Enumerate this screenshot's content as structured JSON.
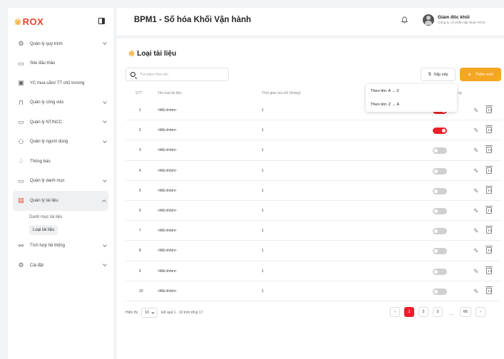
{
  "brand": {
    "logo_text": "ROX",
    "logo_mark": "※",
    "accent_color": "#f5a623",
    "brand_red": "#e8212c"
  },
  "sidebar": {
    "items": [
      {
        "label": "Quản lý quy trình",
        "icon": "workflow-icon",
        "glyph": "⚙",
        "has_chevron": true
      },
      {
        "label": "Site đấu thầu",
        "icon": "monitor-icon",
        "glyph": "▭",
        "has_chevron": false
      },
      {
        "label": "YC mua sắm/ TT chủ trương",
        "icon": "clipboard-icon",
        "glyph": "▣",
        "has_chevron": false
      },
      {
        "label": "Quản lý công việc",
        "icon": "briefcase-icon",
        "glyph": "⊓",
        "has_chevron": true
      },
      {
        "label": "Quản lý NT/NCC",
        "icon": "folder-icon",
        "glyph": "▭",
        "has_chevron": true
      },
      {
        "label": "Quản lý người dùng",
        "icon": "users-icon",
        "glyph": "⚇",
        "has_chevron": true
      },
      {
        "label": "Thông báo",
        "icon": "bell-icon",
        "glyph": "♢",
        "has_chevron": false
      },
      {
        "label": "Quản lý danh mục",
        "icon": "folder-open-icon",
        "glyph": "▭",
        "has_chevron": true
      },
      {
        "label": "Quản lý tài liệu",
        "icon": "document-icon",
        "glyph": "▤",
        "has_chevron": true,
        "active": true
      },
      {
        "label": "Tích hợp hệ thống",
        "icon": "integration-icon",
        "glyph": "⚯",
        "has_chevron": true
      },
      {
        "label": "Cài đặt",
        "icon": "settings-icon",
        "glyph": "⚙",
        "has_chevron": true
      }
    ],
    "sub_items": [
      {
        "label": "Danh mục tài liệu"
      },
      {
        "label": "Loại tài liệu",
        "current": true
      }
    ]
  },
  "header": {
    "title": "BPM1 - Số hóa Khối Vận hành",
    "user_name": "Giám đốc khối",
    "user_org": "Công ty cổ phần tập đoàn ROX"
  },
  "main": {
    "section_title": "Loại tài liệu",
    "search_placeholder": "Tìm kiếm theo tên",
    "sort_label": "Sắp xếp",
    "add_label": "Thêm mới",
    "sort_options": [
      "Theo tên: A → Z",
      "Theo tên: Z → A"
    ],
    "columns": {
      "stt": "STT",
      "name": "Tên loại tài liệu",
      "time": "Thời gian lưu trữ (tháng)",
      "status_partial": "ng"
    },
    "rows": [
      {
        "stt": "1",
        "name": "<Mã nhóm>",
        "time": "1",
        "active": true
      },
      {
        "stt": "2",
        "name": "<Mã nhóm>",
        "time": "1",
        "active": true
      },
      {
        "stt": "3",
        "name": "<Mã nhóm>",
        "time": "1",
        "active": false
      },
      {
        "stt": "4",
        "name": "<Mã nhóm>",
        "time": "1",
        "active": false
      },
      {
        "stt": "5",
        "name": "<Mã nhóm>",
        "time": "1",
        "active": false
      },
      {
        "stt": "6",
        "name": "<Mã nhóm>",
        "time": "1",
        "active": false
      },
      {
        "stt": "7",
        "name": "<Mã nhóm>",
        "time": "1",
        "active": false
      },
      {
        "stt": "8",
        "name": "<Mã nhóm>",
        "time": "1",
        "active": false
      },
      {
        "stt": "9",
        "name": "<Mã nhóm>",
        "time": "1",
        "active": false
      },
      {
        "stt": "10",
        "name": "<Mã nhóm>",
        "time": "1",
        "active": false
      }
    ]
  },
  "footer": {
    "show_label": "Hiển thị",
    "page_size": "10",
    "result_text": "kết quả 1 - 10 trên tổng 17",
    "pages": [
      "1",
      "2",
      "3"
    ],
    "dots": "...",
    "last_page": "66",
    "prev": "‹",
    "next": "›"
  }
}
